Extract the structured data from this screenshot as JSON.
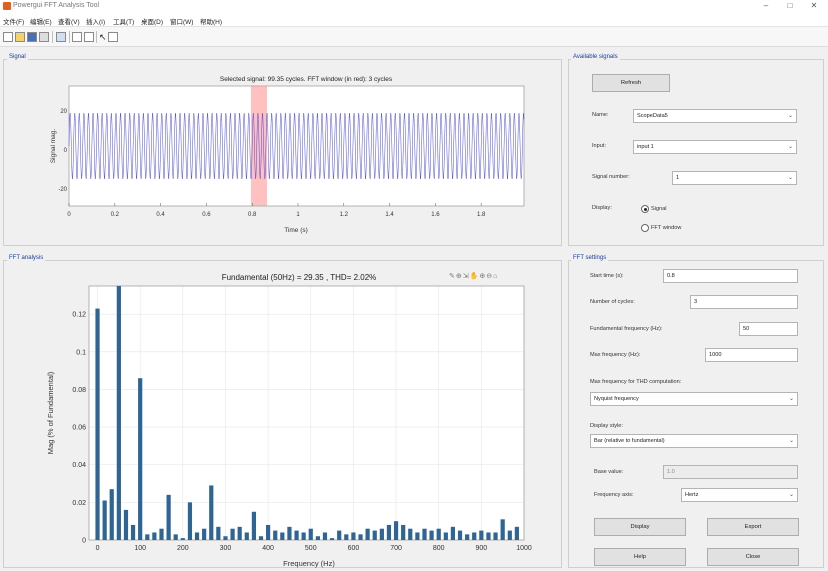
{
  "window": {
    "title": "Powergui FFT Analysis Tool",
    "controls": [
      "–",
      "□",
      "✕"
    ]
  },
  "menu": [
    "文件(F)",
    "编辑(E)",
    "查看(V)",
    "插入(I)",
    "工具(T)",
    "桌面(D)",
    "窗口(W)",
    "帮助(H)"
  ],
  "toolbar_icons": [
    "new-file-icon",
    "open-folder-icon",
    "save-icon",
    "print-icon",
    "print-preview-icon",
    "link-icon",
    "data-cursor-icon",
    "pointer-icon",
    "plot-tools-icon"
  ],
  "signal_panel": {
    "title": "Signal",
    "plot_title": "Selected signal: 99.35 cycles. FFT window (in red): 3 cycles",
    "ylabel": "Signal mag.",
    "xlabel": "Time (s)",
    "xticks": [
      "0",
      "0.2",
      "0.4",
      "0.6",
      "0.8",
      "1",
      "1.2",
      "1.4",
      "1.6",
      "1.8"
    ],
    "yticks": [
      "20",
      "0",
      "-20"
    ]
  },
  "fft_panel": {
    "title": "FFT analysis",
    "axes_toolbar": [
      "brush-icon",
      "data-tip-icon",
      "export-icon",
      "pan-icon",
      "zoom-in-icon",
      "zoom-out-icon",
      "home-icon"
    ]
  },
  "chart_data": {
    "type": "bar",
    "title": "Fundamental (50Hz) = 29.35 , THD= 2.02%",
    "xlabel": "Frequency (Hz)",
    "ylabel": "Mag (% of Fundamental)",
    "xlim": [
      -20,
      1000
    ],
    "ylim": [
      0,
      0.135
    ],
    "xticks": [
      0,
      100,
      200,
      300,
      400,
      500,
      600,
      700,
      800,
      900,
      1000
    ],
    "yticks": [
      0,
      0.02,
      0.04,
      0.06,
      0.08,
      0.1,
      0.12
    ],
    "grid": true,
    "x": [
      0,
      16.7,
      33.3,
      50,
      66.7,
      83.3,
      100,
      116.7,
      133.3,
      150,
      166.7,
      183.3,
      200,
      216.7,
      233.3,
      250,
      266.7,
      283.3,
      300,
      316.7,
      333.3,
      350,
      366.7,
      383.3,
      400,
      416.7,
      433.3,
      450,
      466.7,
      483.3,
      500,
      516.7,
      533.3,
      550,
      566.7,
      583.3,
      600,
      616.7,
      633.3,
      650,
      666.7,
      683.3,
      700,
      716.7,
      733.3,
      750,
      766.7,
      783.3,
      800,
      816.7,
      833.3,
      850,
      866.7,
      883.3,
      900,
      916.7,
      933.3,
      950,
      966.7,
      983.3
    ],
    "values": [
      0.123,
      0.021,
      0.027,
      0.135,
      0.016,
      0.008,
      0.086,
      0.003,
      0.004,
      0.006,
      0.024,
      0.003,
      0.001,
      0.02,
      0.004,
      0.006,
      0.029,
      0.007,
      0.002,
      0.006,
      0.007,
      0.004,
      0.015,
      0.002,
      0.008,
      0.005,
      0.004,
      0.007,
      0.005,
      0.004,
      0.006,
      0.002,
      0.004,
      0.001,
      0.005,
      0.003,
      0.004,
      0.003,
      0.006,
      0.005,
      0.006,
      0.008,
      0.01,
      0.008,
      0.006,
      0.004,
      0.006,
      0.005,
      0.006,
      0.004,
      0.007,
      0.005,
      0.003,
      0.004,
      0.005,
      0.004,
      0.004,
      0.011,
      0.005,
      0.007
    ],
    "color": "#2e6594"
  },
  "available_signals": {
    "title": "Available signals",
    "refresh": "Refresh",
    "name_label": "Name:",
    "name_value": "ScopeData5",
    "input_label": "Input:",
    "input_value": "input 1",
    "signal_number_label": "Signal number:",
    "signal_number_value": "1",
    "display_label": "Display:",
    "display_signal": "Signal",
    "display_fft": "FFT window"
  },
  "fft_settings": {
    "title": "FFT settings",
    "start_time_label": "Start time (s):",
    "start_time_value": "0.8",
    "cycles_label": "Number of cycles:",
    "cycles_value": "3",
    "fund_freq_label": "Fundamental frequency (Hz):",
    "fund_freq_value": "50",
    "max_freq_label": "Max frequency (Hz):",
    "max_freq_value": "1000",
    "thd_label": "Max frequency for THD computation:",
    "thd_value": "Nyquist frequency",
    "display_style_label": "Display style:",
    "display_style_value": "Bar (relative to fundamental)",
    "base_value_label": "Base value:",
    "base_value_value": "1.0",
    "freq_axis_label": "Frequency axis:",
    "freq_axis_value": "Hertz",
    "display_btn": "Display",
    "export_btn": "Export",
    "help_btn": "Help",
    "close_btn": "Close"
  },
  "colors": {
    "signal_wave": "#4a4adc",
    "fft_window": "#ff6e6e",
    "bar": "#2e6594",
    "panel_title": "#1a3c9a"
  }
}
